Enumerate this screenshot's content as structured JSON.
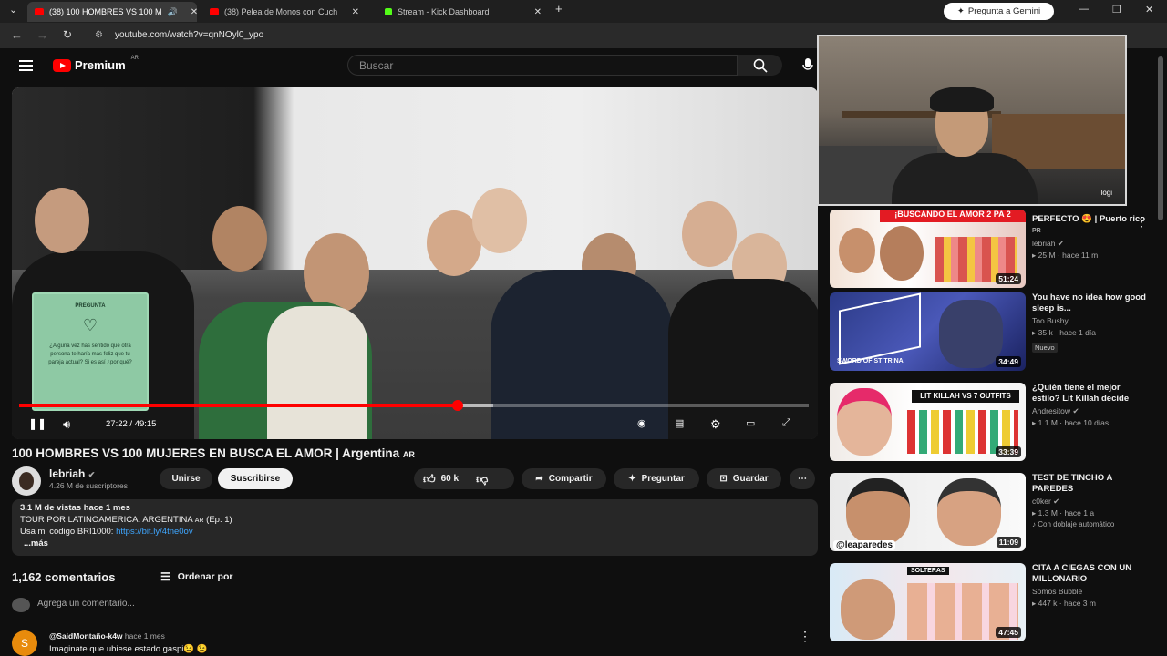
{
  "browser": {
    "tabs": [
      {
        "label": "(38) 100 HOMBRES VS 100 M",
        "color": "#ff0000"
      },
      {
        "label": "(38) Pelea de Monos con Cuch",
        "color": "#ff0000"
      },
      {
        "label": "Stream - Kick Dashboard",
        "color": "#53fc18"
      }
    ],
    "gemini_label": "Pregunta a Gemini",
    "url": "youtube.com/watch?v=qnNOyl0_ypo"
  },
  "header": {
    "brand": "Premium",
    "region": "AR",
    "search_placeholder": "Buscar"
  },
  "player": {
    "card": {
      "heading": "PREGUNTA",
      "text": "¿Alguna vez has sentido que otra persona te haría más feliz que tu pareja actual? Si es así ¿por qué?"
    },
    "time": "27:22 / 49:15",
    "progress": 0.556,
    "buffered": 0.6
  },
  "overlay": {
    "label": "logi"
  },
  "video": {
    "title": "100 HOMBRES VS 100 MUJERES EN BUSCA EL AMOR | Argentina",
    "title_flag": "AR",
    "channel": "lebriah",
    "subscribers": "4.26 M de suscriptores",
    "join_label": "Unirse",
    "subscribe_label": "Suscribirse",
    "likes": "60 k",
    "share_label": "Compartir",
    "ask_label": "Preguntar",
    "save_label": "Guardar"
  },
  "description": {
    "stats": "3.1 M de vistas  hace 1 mes",
    "line1": "TOUR POR LATINOAMERICA: ARGENTINA",
    "line1_flag": "AR",
    "line1_end": "(Ep. 1)",
    "line2": "Usa mi codigo BRI1000: ",
    "link": "https://bit.ly/4tne0ov",
    "more": "...más"
  },
  "comments": {
    "count": "1,162 comentarios",
    "sort_label": "Ordenar por",
    "add_placeholder": "Agrega un comentario...",
    "items": [
      {
        "avatar_letter": "S",
        "user": "@SaidMontaño-k4w",
        "time": "hace 1 mes",
        "text": "Imaginate que ubiese estado gaspi😉 😉"
      }
    ]
  },
  "recommendations": [
    {
      "title": "PERFECTO 😍 | Puerto rico",
      "flag": "PR",
      "channel": "lebriah",
      "views": "25 M",
      "age": "hace 11 m",
      "duration": "51:24",
      "thumb_text": "¡BUSCANDO EL AMOR 2 PA 2",
      "badge": ""
    },
    {
      "title": "You have no idea how good sleep is...",
      "flag": "",
      "channel": "Too Bushy",
      "views": "35 k",
      "age": "hace 1 día",
      "duration": "34:49",
      "thumb_text": "SWORD OF ST TRINA",
      "badge": "Nuevo"
    },
    {
      "title": "¿Quién tiene el mejor estilo? Lit Killah decide",
      "flag": "",
      "channel": "Andresitow",
      "views": "1.1 M",
      "age": "hace 10 días",
      "duration": "33:39",
      "thumb_text": "LIT KILLAH VS 7 OUTFITS",
      "badge": ""
    },
    {
      "title": "TEST DE TINCHO A PAREDES",
      "flag": "",
      "channel": "c0ker",
      "views": "1.3 M",
      "age": "hace 1 a",
      "duration": "11:09",
      "thumb_text": "@leaparedes",
      "badge": "Con doblaje automático"
    },
    {
      "title": "CITA A CIEGAS CON UN MILLONARIO",
      "flag": "",
      "channel": "Somos Bubble",
      "views": "447 k",
      "age": "hace 3 m",
      "duration": "47:45",
      "thumb_text": "SOLTERAS",
      "badge": ""
    }
  ]
}
